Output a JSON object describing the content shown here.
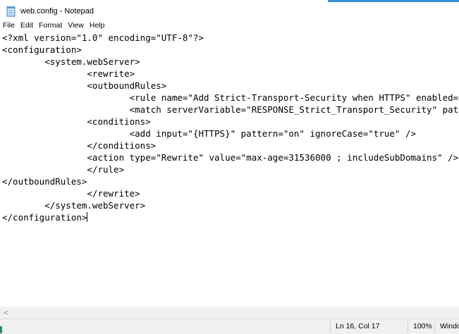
{
  "window": {
    "title": "web.config - Notepad",
    "icon": "notepad-icon"
  },
  "menu": [
    "File",
    "Edit",
    "Format",
    "View",
    "Help"
  ],
  "editor": {
    "lines": [
      "<?xml version=\"1.0\" encoding=\"UTF-8\"?>",
      "<configuration>",
      "        <system.webServer>",
      "                <rewrite>",
      "                <outboundRules>",
      "                        <rule name=\"Add Strict-Transport-Security when HTTPS\" enabled=\"true\">",
      "                        <match serverVariable=\"RESPONSE_Strict_Transport_Security\" pattern=\".*\" />",
      "                <conditions>",
      "                        <add input=\"{HTTPS}\" pattern=\"on\" ignoreCase=\"true\" />",
      "                </conditions>",
      "                <action type=\"Rewrite\" value=\"max-age=31536000 ; includeSubDomains\" />",
      "                </rule>",
      "</outboundRules>",
      "                </rewrite>",
      "        </system.webServer>",
      "</configuration>"
    ]
  },
  "scrollbar": {
    "left_arrow": "<"
  },
  "status": {
    "position": "Ln 16, Col 17",
    "zoom": "100%",
    "line_ending": "Windo"
  },
  "colors": {
    "accent": "#3a8fdc",
    "statusbar_bg": "#f0f0f0"
  }
}
